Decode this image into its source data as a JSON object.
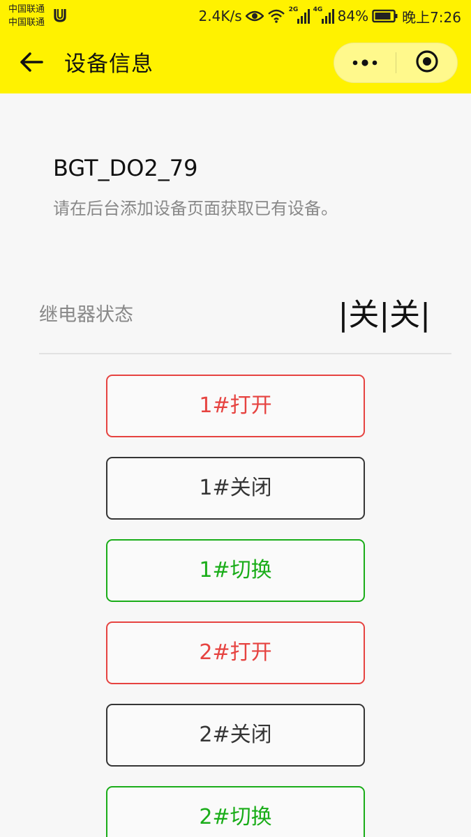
{
  "status_bar": {
    "carrier_1": "中国联通",
    "carrier_2": "中国联通",
    "net_speed": "2.4K/s",
    "sig1_tech": "2G",
    "sig2_tech": "4G",
    "battery": "84%",
    "time": "晚上7:26"
  },
  "navbar": {
    "title": "设备信息",
    "back_icon": "back-arrow-icon",
    "more_icon": "more-dots-icon",
    "close_icon": "target-close-icon"
  },
  "device": {
    "name": "BGT_DO2_79",
    "hint": "请在后台添加设备页面获取已有设备。"
  },
  "relay": {
    "label": "继电器状态",
    "value": "|关|关|"
  },
  "buttons": [
    {
      "label": "1#打开",
      "style": "red"
    },
    {
      "label": "1#关闭",
      "style": "dark"
    },
    {
      "label": "1#切换",
      "style": "green"
    },
    {
      "label": "2#打开",
      "style": "red"
    },
    {
      "label": "2#关闭",
      "style": "dark"
    },
    {
      "label": "2#切换",
      "style": "green"
    }
  ],
  "colors": {
    "header_bg": "#fff200",
    "red": "#e64340",
    "dark": "#353535",
    "green": "#1aad19"
  }
}
